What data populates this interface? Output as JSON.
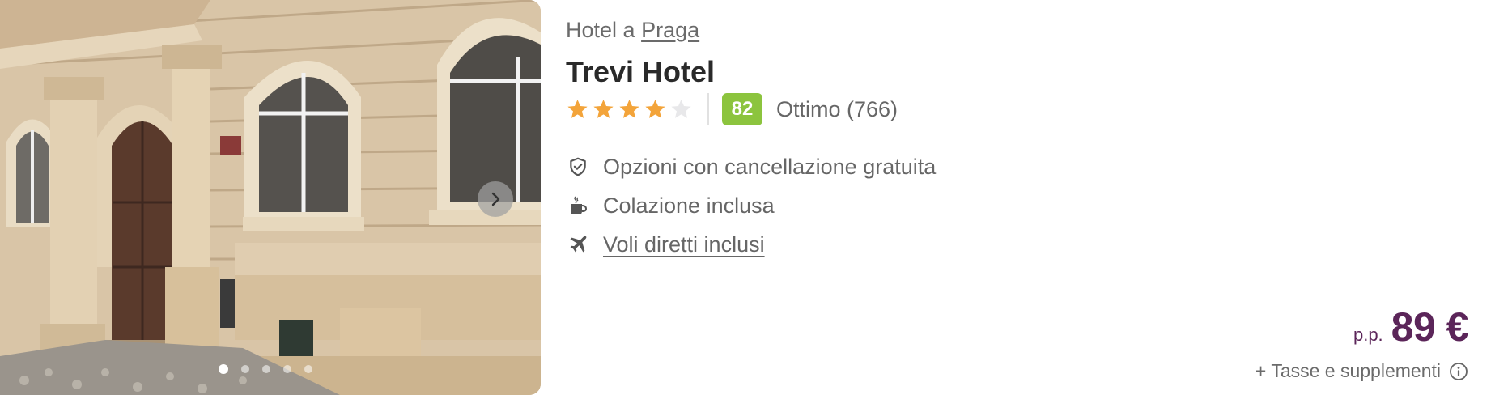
{
  "image": {
    "alt_icon": "building-facade-photo",
    "dots_count": 5,
    "active_dot": 0
  },
  "location": {
    "prefix": "Hotel a",
    "city": "Praga"
  },
  "hotel": {
    "name": "Trevi Hotel",
    "stars": 4,
    "max_stars": 5,
    "score": "82",
    "score_text": "Ottimo (766)"
  },
  "features": [
    {
      "icon": "shield-check-icon",
      "text": "Opzioni con cancellazione gratuita",
      "link": false
    },
    {
      "icon": "coffee-cup-icon",
      "text": "Colazione inclusa",
      "link": false
    },
    {
      "icon": "plane-icon",
      "text": "Voli diretti inclusi",
      "link": true
    }
  ],
  "price": {
    "prefix": "p.p.",
    "amount": "89 €",
    "note": "+ Tasse e supplementi"
  },
  "colors": {
    "star_filled": "#f3a43a",
    "star_empty": "#e8e8ea",
    "score_badge": "#8cc43e",
    "price": "#5b2559"
  }
}
